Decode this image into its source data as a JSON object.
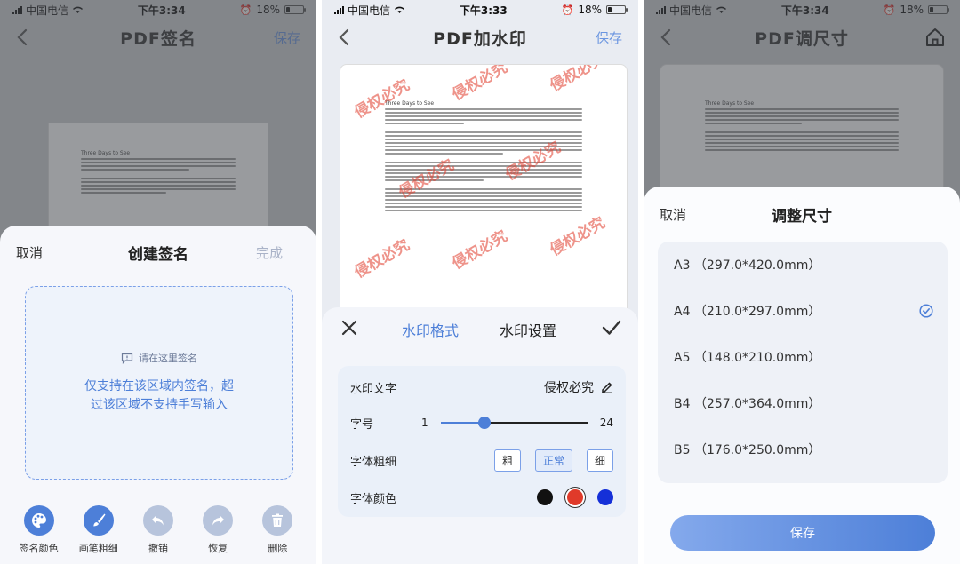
{
  "screens": [
    {
      "status": {
        "carrier": "中国电信",
        "time": "下午3:34",
        "battery": "18%"
      },
      "nav": {
        "title": "PDF签名",
        "action": "保存"
      },
      "sheet": {
        "cancel": "取消",
        "title": "创建签名",
        "done": "完成",
        "hint": "请在这里签名",
        "message": "仅支持在该区域内签名，超过该区域不支持手写输入",
        "tools": [
          {
            "label": "签名颜色",
            "icon": "palette-icon",
            "color": "#4d7fd8"
          },
          {
            "label": "画笔粗细",
            "icon": "brush-icon",
            "color": "#4d7fd8"
          },
          {
            "label": "撤销",
            "icon": "undo-icon",
            "color": "#b7c4dc"
          },
          {
            "label": "恢复",
            "icon": "redo-icon",
            "color": "#b7c4dc"
          },
          {
            "label": "删除",
            "icon": "trash-icon",
            "color": "#b7c4dc"
          }
        ]
      },
      "doc": {
        "heading": "Three Days to See"
      }
    },
    {
      "status": {
        "carrier": "中国电信",
        "time": "下午3:33",
        "battery": "18%"
      },
      "nav": {
        "title": "PDF加水印",
        "action": "保存"
      },
      "doc": {
        "heading": "Three Days to See",
        "watermark": "侵权必究"
      },
      "sheet": {
        "tab_format": "水印格式",
        "tab_settings": "水印设置",
        "text_label": "水印文字",
        "text_value": "侵权必究",
        "size_label": "字号",
        "size_min": "1",
        "size_max": "24",
        "size_fraction": 0.3,
        "weight_label": "字体粗细",
        "weights": [
          "粗",
          "正常",
          "细"
        ],
        "weight_selected": "正常",
        "color_label": "字体颜色",
        "colors": [
          "#111111",
          "#e03a2a",
          "#1530d8"
        ],
        "color_selected": "#e03a2a"
      }
    },
    {
      "status": {
        "carrier": "中国电信",
        "time": "下午3:34",
        "battery": "18%"
      },
      "nav": {
        "title": "PDF调尺寸"
      },
      "doc": {
        "heading": "Three Days to See"
      },
      "sheet": {
        "cancel": "取消",
        "title": "调整尺寸",
        "options": [
          {
            "label": "A3 （297.0*420.0mm）"
          },
          {
            "label": "A4 （210.0*297.0mm）"
          },
          {
            "label": "A5 （148.0*210.0mm）"
          },
          {
            "label": "B4 （257.0*364.0mm）"
          },
          {
            "label": "B5 （176.0*250.0mm）"
          }
        ],
        "selected": "A4 （210.0*297.0mm）",
        "save": "保存"
      }
    }
  ],
  "accent": "#4d7fd8"
}
